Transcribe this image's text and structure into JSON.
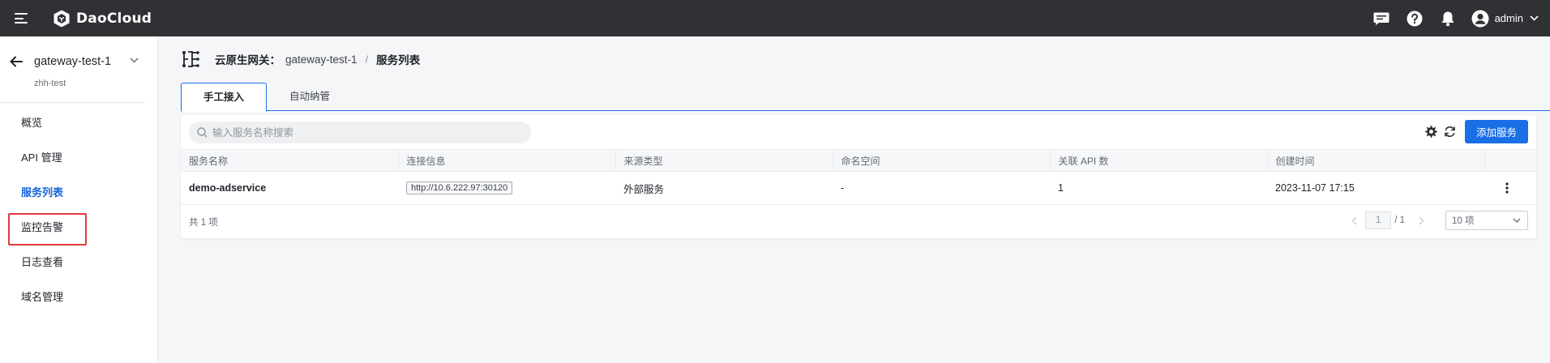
{
  "topbar": {
    "brand": "DaoCloud",
    "user": "admin",
    "icons": [
      "menu-icon",
      "chat-icon",
      "help-icon",
      "bell-icon",
      "user-avatar-icon",
      "chevron-down-icon"
    ],
    "bg_color": "#2f3135"
  },
  "sidebar": {
    "workspace_name": "gateway-test-1",
    "workspace_sub": "zhh-test",
    "items": [
      {
        "label": "概览"
      },
      {
        "label": "API 管理"
      },
      {
        "label": "服务列表"
      },
      {
        "label": "监控告警"
      },
      {
        "label": "日志查看"
      },
      {
        "label": "域名管理"
      }
    ],
    "active_index": 2,
    "highlight_color": "#e03a3a"
  },
  "breadcrumb": {
    "prefix": "云原生网关：",
    "gateway": "gateway-test-1",
    "separator": "/",
    "current": "服务列表"
  },
  "tabs": [
    {
      "label": "手工接入",
      "active": true
    },
    {
      "label": "自动纳管",
      "active": false
    }
  ],
  "toolbar": {
    "search_placeholder": "输入服务名称搜索",
    "add_label": "添加服务",
    "accent_color": "#1a6ee6"
  },
  "table": {
    "columns": [
      "服务名称",
      "连接信息",
      "来源类型",
      "命名空间",
      "关联 API 数",
      "创建时间"
    ],
    "rows": [
      {
        "name": "demo-adservice",
        "connection": "http://10.6.222.97:30120",
        "source": "外部服务",
        "namespace": "-",
        "api_count": "1",
        "created": "2023-11-07 17:15"
      }
    ]
  },
  "footer": {
    "total": "共 1 项",
    "page": "1",
    "page_total": "/ 1",
    "page_size": "10 项"
  }
}
